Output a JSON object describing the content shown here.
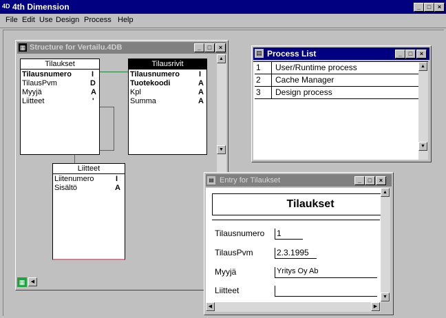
{
  "app": {
    "title": "4th Dimension",
    "menu": [
      "File",
      "Edit",
      "Use",
      "Design",
      "Process",
      "Help"
    ]
  },
  "structure_window": {
    "title": "Structure for Vertailu.4DB",
    "tables": [
      {
        "name": "Tilaukset",
        "fields": [
          {
            "name": "Tilausnumero",
            "type": "I",
            "bold": true
          },
          {
            "name": "TilausPvm",
            "type": "D",
            "bold": false
          },
          {
            "name": "Myyjä",
            "type": "A",
            "bold": false
          },
          {
            "name": "Liitteet",
            "type": "'",
            "bold": false
          }
        ]
      },
      {
        "name": "Tilausrivit",
        "fields": [
          {
            "name": "Tilausnumero",
            "type": "I",
            "bold": true
          },
          {
            "name": "Tuotekoodi",
            "type": "A",
            "bold": true
          },
          {
            "name": "Kpl",
            "type": "A",
            "bold": false
          },
          {
            "name": "Summa",
            "type": "A",
            "bold": false
          }
        ]
      },
      {
        "name": "Liitteet",
        "fields": [
          {
            "name": "Liitenumero",
            "type": "I",
            "bold": false
          },
          {
            "name": "Sisältö",
            "type": "A",
            "bold": false
          }
        ]
      }
    ]
  },
  "process_list": {
    "title": "Process List",
    "rows": [
      {
        "num": "1",
        "name": "User/Runtime process"
      },
      {
        "num": "2",
        "name": "Cache Manager"
      },
      {
        "num": "3",
        "name": "Design process"
      }
    ]
  },
  "entry_window": {
    "title": "Entry for Tilaukset",
    "header": "Tilaukset",
    "fields": [
      {
        "label": "Tilausnumero",
        "value": "1"
      },
      {
        "label": "TilausPvm",
        "value": "2.3.1995"
      },
      {
        "label": "Myyjä",
        "value": "Yritys Oy Ab"
      },
      {
        "label": "Liitteet",
        "value": ""
      }
    ]
  },
  "colors": {
    "titlebar_active": "#000080",
    "titlebar_inactive": "#808080",
    "desktop": "#c0c0c0"
  }
}
